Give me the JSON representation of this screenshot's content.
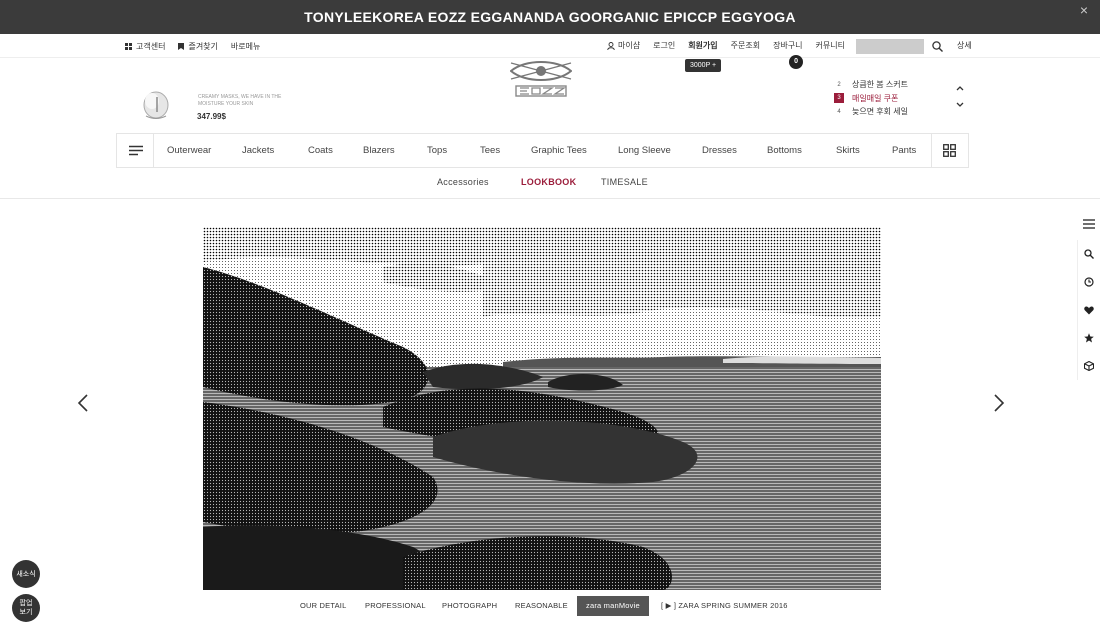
{
  "banner": {
    "title": "TONYLEEKOREA EOZZ EGGANANDA GOORGANIC EPICCP EGGYOGA",
    "close_label": "×"
  },
  "util_left": [
    {
      "label": "고객센터",
      "icon": "grid-icon"
    },
    {
      "label": "즐겨찾기",
      "icon": "bookmark-icon"
    },
    {
      "label": "바로메뉴",
      "icon": ""
    }
  ],
  "util_right": {
    "my_shop": "마이샵",
    "login": "로그인",
    "join": "회원가입",
    "order": "주문조회",
    "cart": "장바구니",
    "cart_count": "0",
    "community": "커뮤니티",
    "search_placeholder": "",
    "detail": "상세",
    "points_tooltip": "3000P +"
  },
  "promo": {
    "text": "CREAMY MASKS, WE HAVE IN THE MOISTURE YOUR SKIN",
    "price": "347.99$"
  },
  "ranking": [
    {
      "num": "2",
      "label": "상큼한 봄 스커트",
      "hot": false
    },
    {
      "num": "3",
      "label": "매일매일 쿠폰",
      "hot": true
    },
    {
      "num": "4",
      "label": "늦으면 후회 세일",
      "hot": false
    }
  ],
  "categories": [
    "Outerwear",
    "Jackets",
    "Coats",
    "Blazers",
    "Tops",
    "Tees",
    "Graphic Tees",
    "Long Sleeve",
    "Dresses",
    "Bottoms",
    "Skirts",
    "Pants"
  ],
  "sub_nav": [
    "Accessories",
    "LOOKBOOK",
    "TIMESALE"
  ],
  "sub_nav_active": "LOOKBOOK",
  "tabs": [
    "OUR DETAIL",
    "PROFESSIONAL",
    "PHOTOGRAPH",
    "REASONABLE",
    "zara manMovie",
    "[ ▶ ] ZARA SPRING SUMMER 2016"
  ],
  "active_tab": "zara manMovie",
  "bubbles": [
    "새소식",
    "팝업보기"
  ],
  "bubble2_lines": [
    "팝업",
    "보기"
  ],
  "colors": {
    "accent": "#9b1d3b",
    "banner": "#3b3b3b"
  }
}
